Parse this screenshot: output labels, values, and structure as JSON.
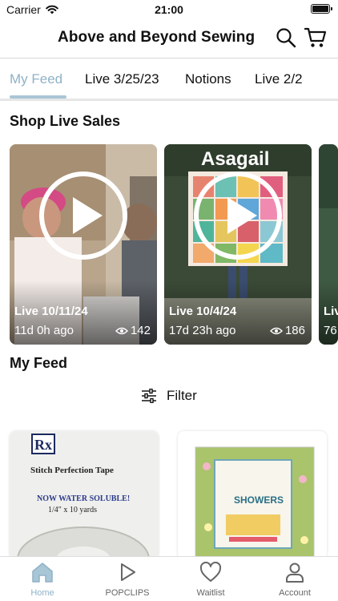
{
  "status_bar": {
    "carrier": "Carrier",
    "time": "21:00"
  },
  "header": {
    "title": "Above and Beyond Sewing"
  },
  "tabs": [
    {
      "label": "My Feed",
      "active": true
    },
    {
      "label": "Live 3/25/23",
      "active": false
    },
    {
      "label": "Notions",
      "active": false
    },
    {
      "label": "Live 2/2",
      "active": false
    }
  ],
  "live_section": {
    "title": "Shop Live Sales"
  },
  "live_cards": [
    {
      "date": "Live 10/11/24",
      "ago": "11d 0h ago",
      "views": "142"
    },
    {
      "date": "Live 10/4/24",
      "ago": "17d 23h ago",
      "views": "186",
      "overlay_text": "Asagail"
    },
    {
      "date": "Liv",
      "ago": "76"
    }
  ],
  "feed_section": {
    "title": "My Feed",
    "filter_label": "Filter"
  },
  "products": [
    {
      "brand_logo": "Rx",
      "line1": "Stitch Perfection Tape",
      "line2": "NOW WATER SOLUBLE!",
      "line3": "1/4\" x 10 yards"
    },
    {
      "line1": "SHOWERS"
    }
  ],
  "bottom_nav": [
    {
      "label": "Home",
      "icon": "home-icon",
      "active": true
    },
    {
      "label": "POPCLIPS",
      "icon": "play-icon",
      "active": false
    },
    {
      "label": "Waitlist",
      "icon": "heart-icon",
      "active": false
    },
    {
      "label": "Account",
      "icon": "person-icon",
      "active": false
    }
  ],
  "colors": {
    "accent": "#8fb2c7",
    "tab_rule": "#e6e6e6"
  }
}
